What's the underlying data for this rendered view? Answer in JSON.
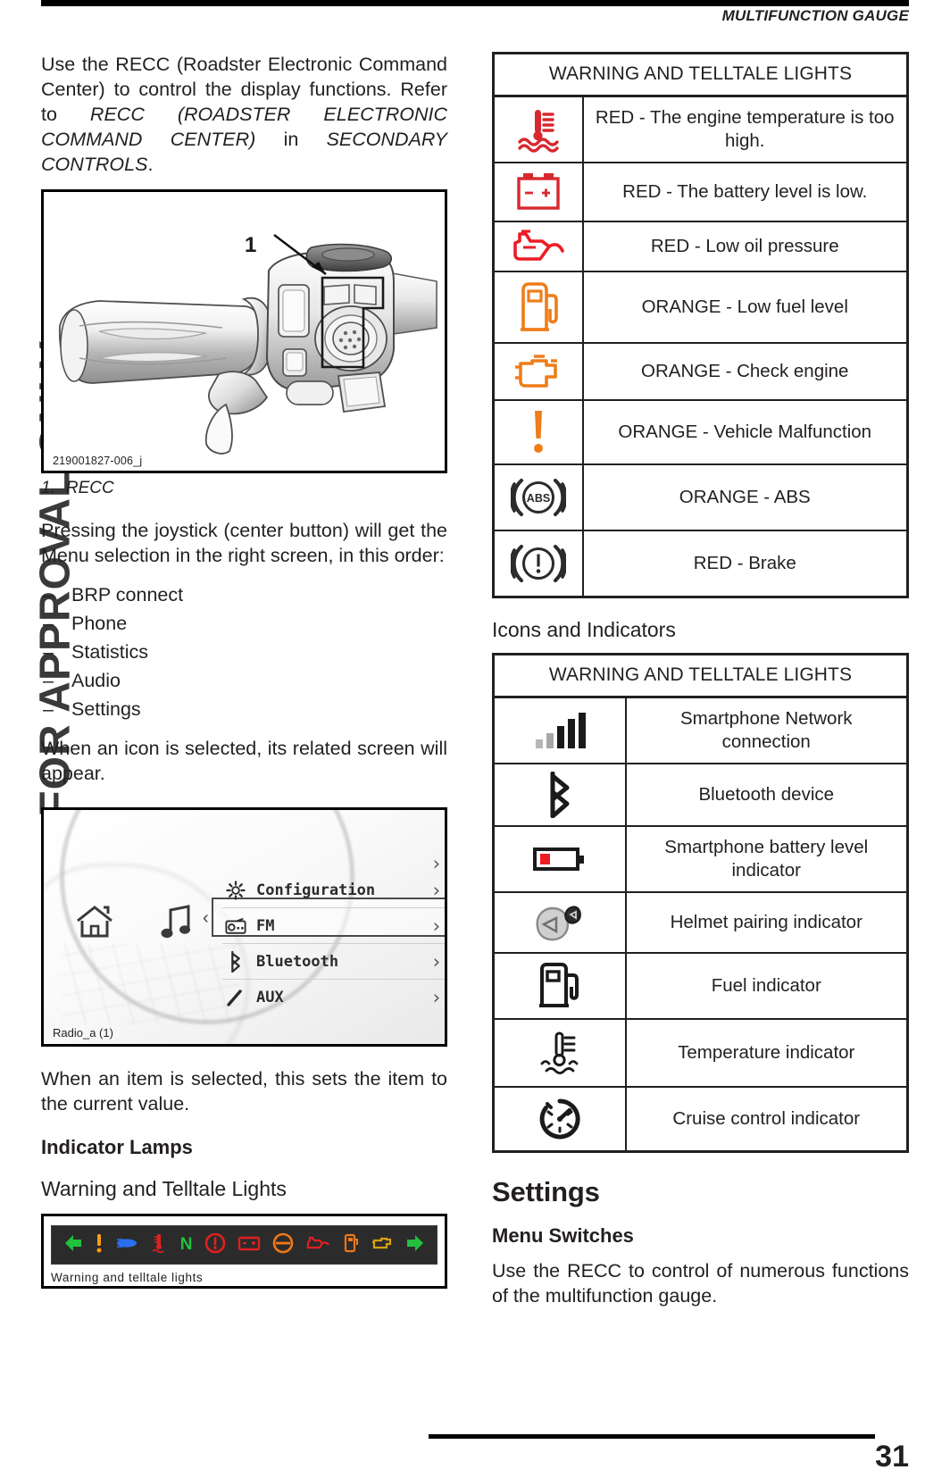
{
  "header": {
    "title": "MULTIFUNCTION GAUGE"
  },
  "watermark": "FOR APPROVAL ONLY",
  "page_number": "31",
  "left_column": {
    "intro_paragraph": {
      "part1": "Use the RECC (Roadster Electronic Command Center) to control the display functions.  Refer to ",
      "ref1": "RECC (ROADSTER ELECTRONIC COMMAND CENTER)",
      "part2": " in ",
      "ref2": "SECONDARY CONTROLS",
      "part3": "."
    },
    "figure1": {
      "callout_label": "1",
      "image_id": "219001827-006_j",
      "caption_number": "1.",
      "caption_text": "RECC"
    },
    "joystick_paragraph": "Pressing the joystick (center button) will get the Menu selection in the right screen, in this order:",
    "menu_order": [
      "BRP connect",
      "Phone",
      "Statistics",
      "Audio",
      "Settings"
    ],
    "dash_glyph": "–",
    "icon_paragraph": "When an icon is selected, its related screen will appear.",
    "figure2": {
      "image_id": "Radio_a  (1)",
      "home_icon": "home-icon",
      "note_icon": "music-note-icon",
      "back_chevron": "‹",
      "rows": [
        {
          "icon": "gear-icon",
          "label": "Configuration",
          "chevron": "›"
        },
        {
          "icon": "radio-icon",
          "label": "FM",
          "chevron": "›"
        },
        {
          "icon": "bluetooth-icon",
          "label": "Bluetooth",
          "chevron": "›"
        },
        {
          "icon": "aux-icon",
          "label": "AUX",
          "chevron": "›"
        }
      ],
      "top_chevron": "›"
    },
    "item_paragraph": "When an item is selected, this sets the item to the current value.",
    "heading_indicator_lamps": "Indicator Lamps",
    "heading_warning_telltale": "Warning and Telltale Lights",
    "figure3": {
      "caption": "Warning  and  telltale  lights",
      "lamps": [
        {
          "name": "left-turn-arrow-lamp",
          "glyph": "⬅",
          "color": "#22c03c"
        },
        {
          "name": "vehicle-malfunction-lamp",
          "glyph": "!",
          "color": "#f5a012"
        },
        {
          "name": "high-beam-lamp",
          "glyph": "▬",
          "color": "#2a6ff0"
        },
        {
          "name": "engine-temperature-lamp",
          "glyph": "↓",
          "color": "#e02020"
        },
        {
          "name": "neutral-lamp",
          "glyph": "N",
          "color": "#22c03c"
        },
        {
          "name": "brake-lamp",
          "glyph": "ⓧ",
          "color": "#e02020"
        },
        {
          "name": "battery-lamp",
          "glyph": "▭",
          "color": "#e02020"
        },
        {
          "name": "abs-lamp",
          "glyph": "⊖",
          "color": "#f07818"
        },
        {
          "name": "oil-pressure-lamp",
          "glyph": "☁",
          "color": "#e02020"
        },
        {
          "name": "fuel-lamp",
          "glyph": "⛽",
          "color": "#f07818"
        },
        {
          "name": "check-engine-lamp",
          "glyph": "⬭",
          "color": "#d8a010"
        },
        {
          "name": "right-turn-arrow-lamp",
          "glyph": "➡",
          "color": "#22c03c"
        }
      ]
    }
  },
  "right_column": {
    "table1": {
      "header": "WARNING AND TELLTALE LIGHTS",
      "rows": [
        {
          "icon": "engine-temperature-icon",
          "color": "#d8282f",
          "text": "RED - The engine temperature is too high."
        },
        {
          "icon": "battery-icon",
          "color": "#d8282f",
          "text": "RED - The battery level is low."
        },
        {
          "icon": "oil-pressure-icon",
          "color": "#ed1c24",
          "text": "RED - Low oil pressure"
        },
        {
          "icon": "fuel-pump-icon",
          "color": "#ef7d1a",
          "text": "ORANGE - Low fuel level"
        },
        {
          "icon": "check-engine-icon",
          "color": "#ef7d1a",
          "text": "ORANGE - Check engine"
        },
        {
          "icon": "exclamation-icon",
          "color": "#ef7d1a",
          "text": "ORANGE - Vehicle Malfunction"
        },
        {
          "icon": "abs-icon",
          "color": "#2b2b2b",
          "text": "ORANGE - ABS"
        },
        {
          "icon": "brake-icon",
          "color": "#2b2b2b",
          "text": "RED - Brake"
        }
      ]
    },
    "heading_icons_indicators": "Icons and Indicators",
    "table2": {
      "header": "WARNING AND TELLTALE LIGHTS",
      "rows": [
        {
          "icon": "signal-bars-icon",
          "color": "#1a1a1a",
          "text": "Smartphone Network connection"
        },
        {
          "icon": "bluetooth-icon",
          "color": "#1a1a1a",
          "text": "Bluetooth device"
        },
        {
          "icon": "phone-battery-icon",
          "color": "#1a1a1a",
          "text": "Smartphone battery level indicator"
        },
        {
          "icon": "helmet-pairing-icon",
          "color": "#1a1a1a",
          "text": "Helmet pairing indicator"
        },
        {
          "icon": "fuel-indicator-icon",
          "color": "#1a1a1a",
          "text": "Fuel indicator"
        },
        {
          "icon": "temperature-indicator-icon",
          "color": "#1a1a1a",
          "text": "Temperature indicator"
        },
        {
          "icon": "cruise-control-icon",
          "color": "#1a1a1a",
          "text": "Cruise control indicator"
        }
      ]
    },
    "heading_settings": "Settings",
    "heading_menu_switches": "Menu Switches",
    "settings_paragraph": "Use the RECC to control of numerous functions of the multifunction gauge."
  }
}
